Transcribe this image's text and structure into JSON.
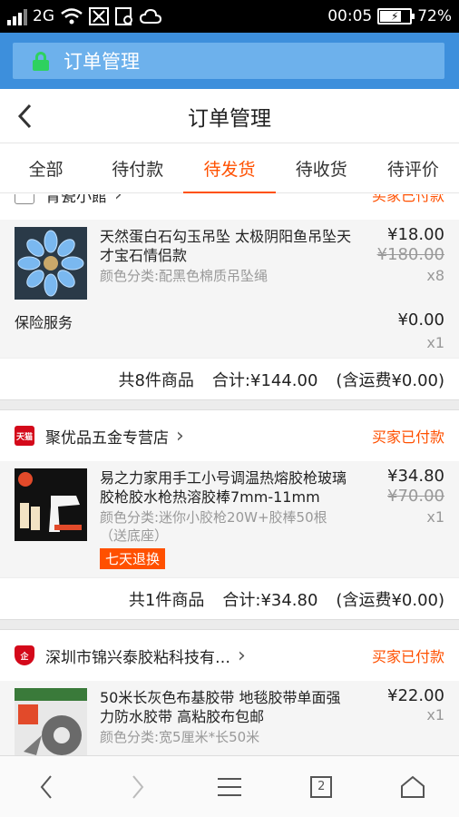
{
  "status_bar": {
    "network": "2G",
    "time": "00:05",
    "battery": "72%",
    "battery_level": 0.72
  },
  "browser": {
    "url_title": "订单管理",
    "lock_icon": "lock-icon"
  },
  "header": {
    "title": "订单管理",
    "back_icon": "chevron-left-icon"
  },
  "tabs": [
    {
      "label": "全部"
    },
    {
      "label": "待付款"
    },
    {
      "label": "待发货"
    },
    {
      "label": "待收货"
    },
    {
      "label": "待评价"
    }
  ],
  "active_tab": "待发货",
  "orders": [
    {
      "shop_name": "青瓷小館",
      "status": "买家已付款",
      "item": {
        "title": "天然蛋白石勾玉吊坠 太极阴阳鱼吊坠天才宝石情侣款",
        "sku": "颜色分类:配黑色棉质吊坠绳",
        "price": "¥18.00",
        "old_price": "¥180.00",
        "qty": "x8"
      },
      "service": {
        "label": "保险服务",
        "price": "¥0.00",
        "qty": "x1"
      },
      "summary": {
        "count": "共8件商品",
        "total": "合计:¥144.00",
        "shipping": "(含运费¥0.00)"
      }
    },
    {
      "shop_name": "聚优品五金专营店",
      "shop_badge": "天猫",
      "status": "买家已付款",
      "item": {
        "title": "易之力家用手工小号调温热熔胶枪玻璃胶枪胶水枪热溶胶棒7mm-11mm",
        "sku": "颜色分类:迷你小胶枪20W+胶棒50根（送底座）",
        "price": "¥34.80",
        "old_price": "¥70.00",
        "qty": "x1",
        "badge": "七天退换"
      },
      "summary": {
        "count": "共1件商品",
        "total": "合计:¥34.80",
        "shipping": "(含运费¥0.00)"
      }
    },
    {
      "shop_name": "深圳市锦兴泰胶粘科技有…",
      "shop_badge": "企",
      "status": "买家已付款",
      "item": {
        "title": "50米长灰色布基胶带 地毯胶带单面强力防水胶带 高粘胶布包邮",
        "sku": "颜色分类:宽5厘米*长50米",
        "price": "¥22.00",
        "qty": "x1"
      }
    }
  ],
  "bottom_nav": {
    "back_icon": "nav-back-icon",
    "forward_icon": "nav-forward-icon",
    "menu_icon": "menu-icon",
    "tabs_count": "2",
    "home_icon": "home-icon"
  },
  "colors": {
    "accent": "#ff5000",
    "browser_bar": "#3d8fdc",
    "url_box": "#6db1ec",
    "lock": "#2ed15f"
  }
}
